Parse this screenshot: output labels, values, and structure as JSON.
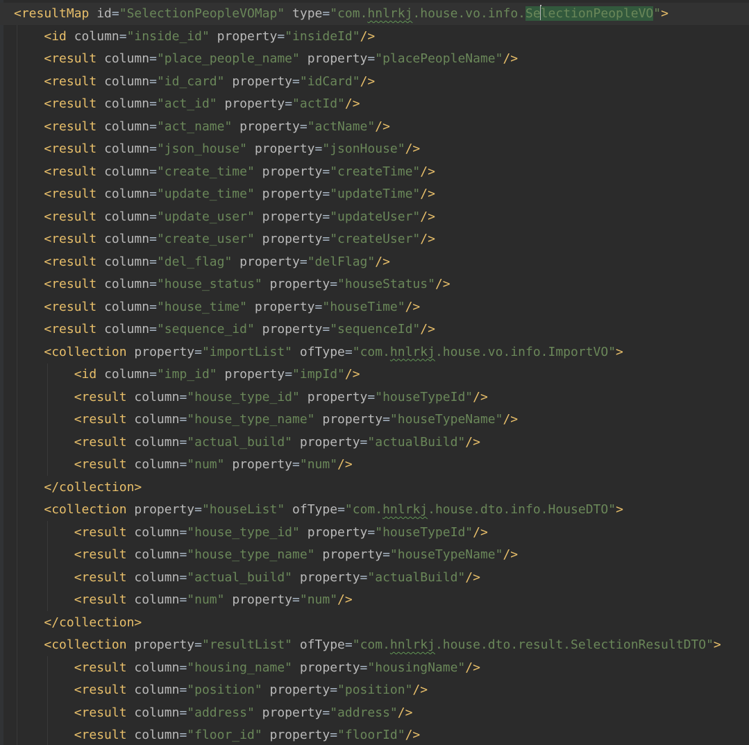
{
  "lines": [
    {
      "indent": 0,
      "tag": "<resultMap",
      "attrs": [
        {
          "name": "id",
          "value": "\"SelectionPeopleVOMap\""
        },
        {
          "name": "type",
          "parts": [
            {
              "t": "\"com."
            },
            {
              "t": "hnlrkj",
              "typo": true
            },
            {
              "t": ".house.vo.info."
            },
            {
              "t": "Se",
              "match": true,
              "caretAfter": true
            },
            {
              "t": "lectionPeopleVO",
              "match": true
            },
            {
              "t": "\""
            }
          ]
        }
      ],
      "close": ">"
    },
    {
      "indent": 1,
      "tag": "<id",
      "attrs": [
        {
          "name": "column",
          "value": "\"inside_id\""
        },
        {
          "name": "property",
          "value": "\"insideId\""
        }
      ],
      "close": "/>"
    },
    {
      "indent": 1,
      "tag": "<result",
      "attrs": [
        {
          "name": "column",
          "value": "\"place_people_name\""
        },
        {
          "name": "property",
          "value": "\"placePeopleName\""
        }
      ],
      "close": "/>"
    },
    {
      "indent": 1,
      "tag": "<result",
      "attrs": [
        {
          "name": "column",
          "value": "\"id_card\""
        },
        {
          "name": "property",
          "value": "\"idCard\""
        }
      ],
      "close": "/>"
    },
    {
      "indent": 1,
      "tag": "<result",
      "attrs": [
        {
          "name": "column",
          "value": "\"act_id\""
        },
        {
          "name": "property",
          "value": "\"actId\""
        }
      ],
      "close": "/>"
    },
    {
      "indent": 1,
      "tag": "<result",
      "attrs": [
        {
          "name": "column",
          "value": "\"act_name\""
        },
        {
          "name": "property",
          "value": "\"actName\""
        }
      ],
      "close": "/>"
    },
    {
      "indent": 1,
      "tag": "<result",
      "attrs": [
        {
          "name": "column",
          "value": "\"json_house\""
        },
        {
          "name": "property",
          "value": "\"jsonHouse\""
        }
      ],
      "close": "/>"
    },
    {
      "indent": 1,
      "tag": "<result",
      "attrs": [
        {
          "name": "column",
          "value": "\"create_time\""
        },
        {
          "name": "property",
          "value": "\"createTime\""
        }
      ],
      "close": "/>"
    },
    {
      "indent": 1,
      "tag": "<result",
      "attrs": [
        {
          "name": "column",
          "value": "\"update_time\""
        },
        {
          "name": "property",
          "value": "\"updateTime\""
        }
      ],
      "close": "/>"
    },
    {
      "indent": 1,
      "tag": "<result",
      "attrs": [
        {
          "name": "column",
          "value": "\"update_user\""
        },
        {
          "name": "property",
          "value": "\"updateUser\""
        }
      ],
      "close": "/>"
    },
    {
      "indent": 1,
      "tag": "<result",
      "attrs": [
        {
          "name": "column",
          "value": "\"create_user\""
        },
        {
          "name": "property",
          "value": "\"createUser\""
        }
      ],
      "close": "/>"
    },
    {
      "indent": 1,
      "tag": "<result",
      "attrs": [
        {
          "name": "column",
          "value": "\"del_flag\""
        },
        {
          "name": "property",
          "value": "\"delFlag\""
        }
      ],
      "close": "/>"
    },
    {
      "indent": 1,
      "tag": "<result",
      "attrs": [
        {
          "name": "column",
          "value": "\"house_status\""
        },
        {
          "name": "property",
          "value": "\"houseStatus\""
        }
      ],
      "close": "/>"
    },
    {
      "indent": 1,
      "tag": "<result",
      "attrs": [
        {
          "name": "column",
          "value": "\"house_time\""
        },
        {
          "name": "property",
          "value": "\"houseTime\""
        }
      ],
      "close": "/>"
    },
    {
      "indent": 1,
      "tag": "<result",
      "attrs": [
        {
          "name": "column",
          "value": "\"sequence_id\""
        },
        {
          "name": "property",
          "value": "\"sequenceId\""
        }
      ],
      "close": "/>"
    },
    {
      "indent": 1,
      "tag": "<collection",
      "attrs": [
        {
          "name": "property",
          "value": "\"importList\""
        },
        {
          "name": "ofType",
          "parts": [
            {
              "t": "\"com."
            },
            {
              "t": "hnlrkj",
              "typo": true
            },
            {
              "t": ".house.vo.info.ImportVO\""
            }
          ]
        }
      ],
      "close": ">"
    },
    {
      "indent": 2,
      "tag": "<id",
      "attrs": [
        {
          "name": "column",
          "value": "\"imp_id\""
        },
        {
          "name": "property",
          "value": "\"impId\""
        }
      ],
      "close": "/>"
    },
    {
      "indent": 2,
      "tag": "<result",
      "attrs": [
        {
          "name": "column",
          "value": "\"house_type_id\""
        },
        {
          "name": "property",
          "value": "\"houseTypeId\""
        }
      ],
      "close": "/>"
    },
    {
      "indent": 2,
      "tag": "<result",
      "attrs": [
        {
          "name": "column",
          "value": "\"house_type_name\""
        },
        {
          "name": "property",
          "value": "\"houseTypeName\""
        }
      ],
      "close": "/>"
    },
    {
      "indent": 2,
      "tag": "<result",
      "attrs": [
        {
          "name": "column",
          "value": "\"actual_build\""
        },
        {
          "name": "property",
          "value": "\"actualBuild\""
        }
      ],
      "close": "/>"
    },
    {
      "indent": 2,
      "tag": "<result",
      "attrs": [
        {
          "name": "column",
          "value": "\"num\""
        },
        {
          "name": "property",
          "value": "\"num\""
        }
      ],
      "close": "/>"
    },
    {
      "indent": 1,
      "tag": "</collection",
      "attrs": [],
      "close": ">"
    },
    {
      "indent": 1,
      "tag": "<collection",
      "attrs": [
        {
          "name": "property",
          "value": "\"houseList\""
        },
        {
          "name": "ofType",
          "parts": [
            {
              "t": "\"com."
            },
            {
              "t": "hnlrkj",
              "typo": true
            },
            {
              "t": ".house.dto.info.HouseDTO\""
            }
          ]
        }
      ],
      "close": ">"
    },
    {
      "indent": 2,
      "tag": "<result",
      "attrs": [
        {
          "name": "column",
          "value": "\"house_type_id\""
        },
        {
          "name": "property",
          "value": "\"houseTypeId\""
        }
      ],
      "close": "/>"
    },
    {
      "indent": 2,
      "tag": "<result",
      "attrs": [
        {
          "name": "column",
          "value": "\"house_type_name\""
        },
        {
          "name": "property",
          "value": "\"houseTypeName\""
        }
      ],
      "close": "/>"
    },
    {
      "indent": 2,
      "tag": "<result",
      "attrs": [
        {
          "name": "column",
          "value": "\"actual_build\""
        },
        {
          "name": "property",
          "value": "\"actualBuild\""
        }
      ],
      "close": "/>"
    },
    {
      "indent": 2,
      "tag": "<result",
      "attrs": [
        {
          "name": "column",
          "value": "\"num\""
        },
        {
          "name": "property",
          "value": "\"num\""
        }
      ],
      "close": "/>"
    },
    {
      "indent": 1,
      "tag": "</collection",
      "attrs": [],
      "close": ">"
    },
    {
      "indent": 1,
      "tag": "<collection",
      "attrs": [
        {
          "name": "property",
          "value": "\"resultList\""
        },
        {
          "name": "ofType",
          "parts": [
            {
              "t": "\"com."
            },
            {
              "t": "hnlrkj",
              "typo": true
            },
            {
              "t": ".house.dto.result.SelectionResultDTO\""
            }
          ]
        }
      ],
      "close": ">"
    },
    {
      "indent": 2,
      "tag": "<result",
      "attrs": [
        {
          "name": "column",
          "value": "\"housing_name\""
        },
        {
          "name": "property",
          "value": "\"housingName\""
        }
      ],
      "close": "/>"
    },
    {
      "indent": 2,
      "tag": "<result",
      "attrs": [
        {
          "name": "column",
          "value": "\"position\""
        },
        {
          "name": "property",
          "value": "\"position\""
        }
      ],
      "close": "/>"
    },
    {
      "indent": 2,
      "tag": "<result",
      "attrs": [
        {
          "name": "column",
          "value": "\"address\""
        },
        {
          "name": "property",
          "value": "\"address\""
        }
      ],
      "close": "/>"
    },
    {
      "indent": 2,
      "tag": "<result",
      "attrs": [
        {
          "name": "column",
          "value": "\"floor_id\""
        },
        {
          "name": "property",
          "value": "\"floorId\""
        }
      ],
      "close": "/>"
    }
  ],
  "colors": {
    "background": "#2b2b2b",
    "tag": "#e8bf6a",
    "attribute": "#bababa",
    "string": "#6a8759"
  }
}
